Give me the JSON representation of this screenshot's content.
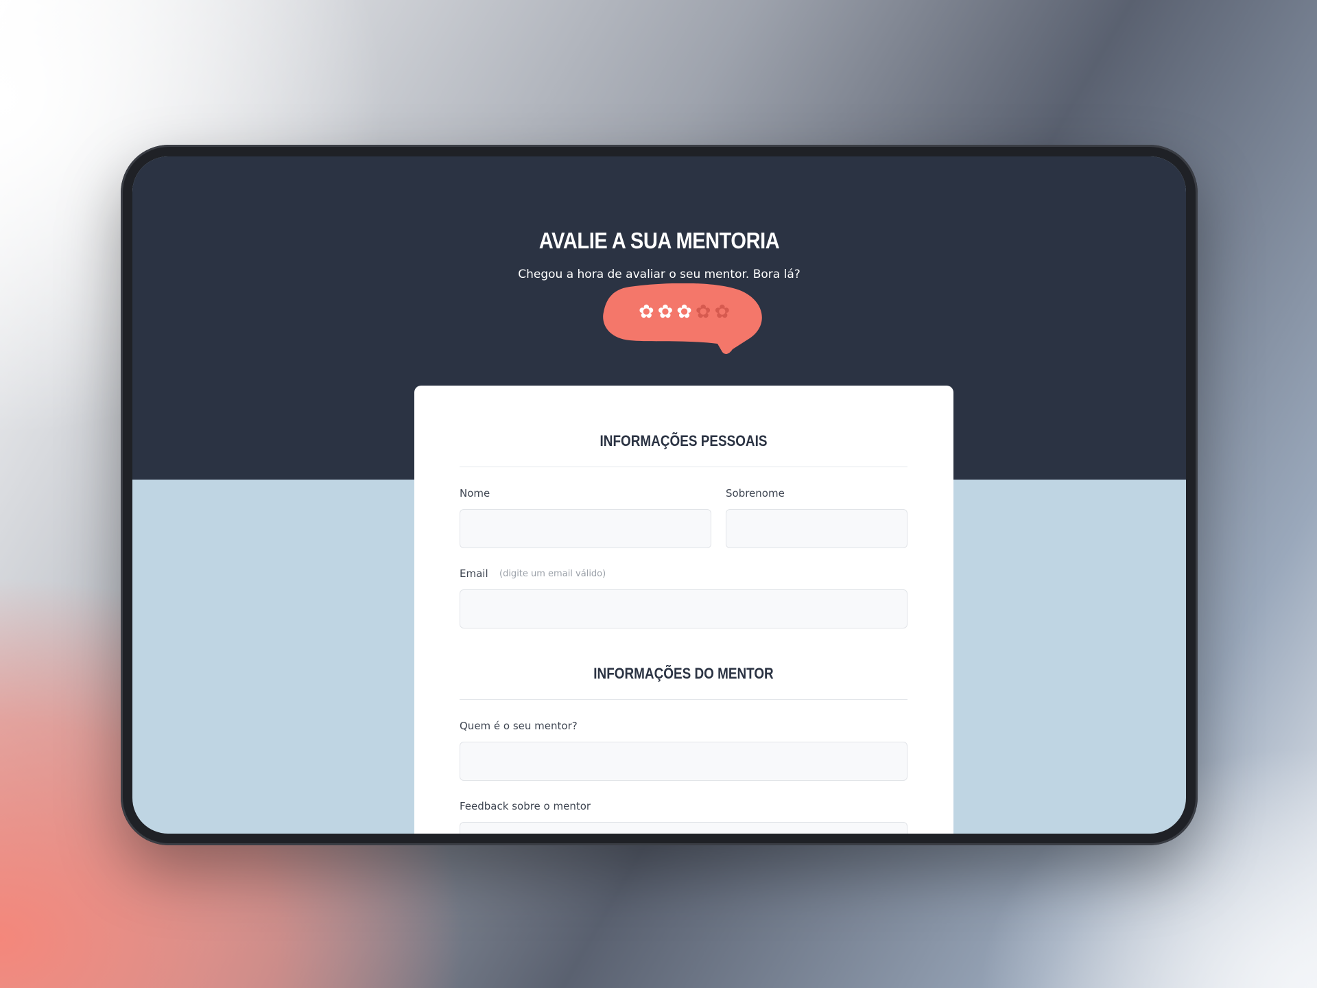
{
  "header": {
    "title": "AVALIE A SUA MENTORIA",
    "subtitle": "Chegou a hora de avaliar o seu mentor. Bora lá?",
    "rating": {
      "value": 3,
      "max": 5
    },
    "colors": {
      "header_bg": "#2b3343",
      "accent": "#f4776a",
      "page_bg": "#bfd5e3"
    }
  },
  "form": {
    "personal_section": {
      "title": "INFORMAÇÕES PESSOAIS",
      "first_name_label": "Nome",
      "last_name_label": "Sobrenome",
      "email_label": "Email",
      "email_hint": "(digite um email válido)",
      "first_name_value": "",
      "last_name_value": "",
      "email_value": ""
    },
    "mentor_section": {
      "title": "INFORMAÇÕES DO MENTOR",
      "mentor_label": "Quem é o seu mentor?",
      "feedback_label": "Feedback sobre o mentor",
      "mentor_value": ""
    }
  }
}
